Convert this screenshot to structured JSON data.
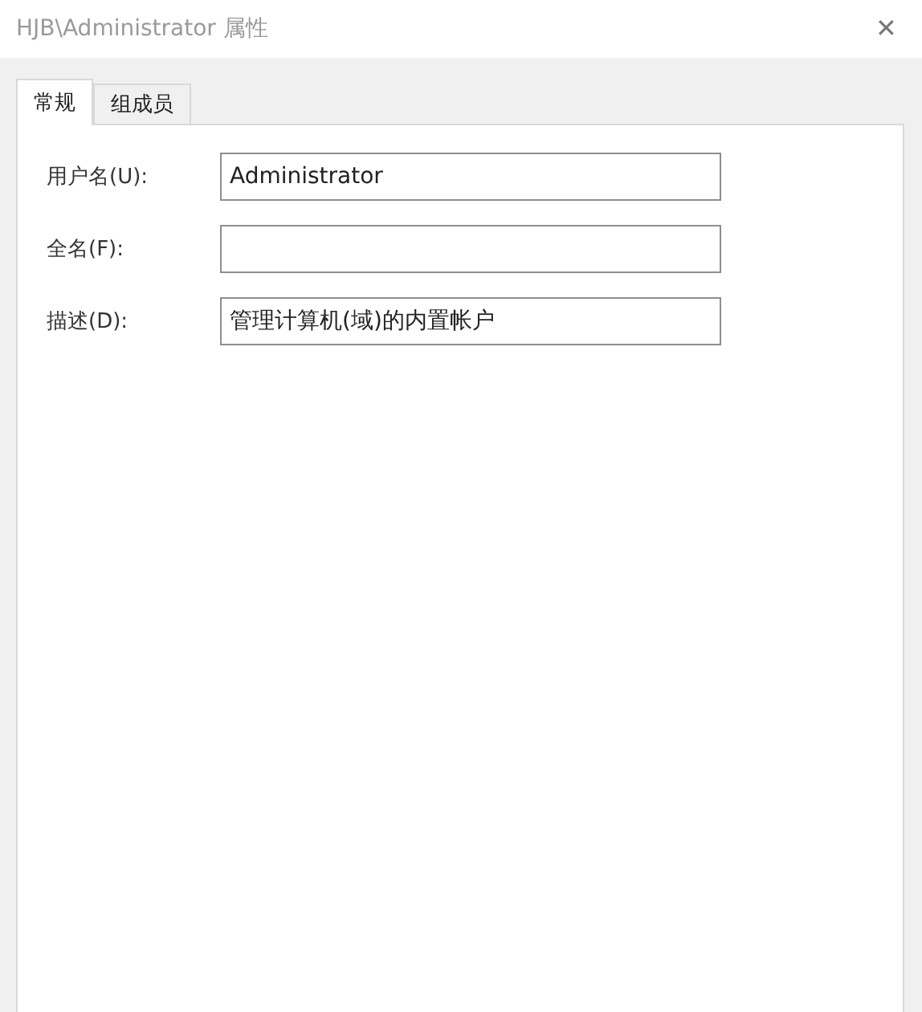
{
  "window": {
    "title": "HJB\\Administrator 属性",
    "close": "✕"
  },
  "tabs": [
    {
      "label": "常规",
      "selected": true
    },
    {
      "label": "组成员",
      "selected": false
    }
  ],
  "fields": [
    {
      "label": "用户名(U):",
      "value": "Administrator"
    },
    {
      "label": "全名(F):"
    },
    {
      "label": "描述(D):",
      "value": "管理计算机(域)的内置帐户"
    }
  ]
}
